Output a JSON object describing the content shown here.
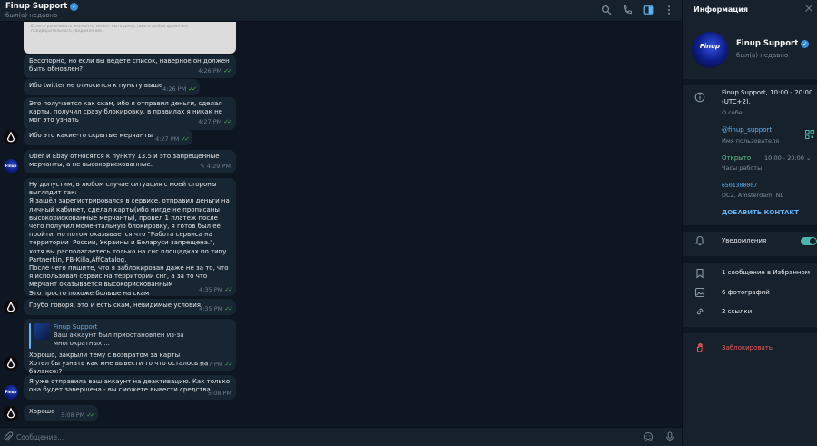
{
  "header": {
    "title": "Finup Support",
    "status": "был(а) недавно"
  },
  "image_fragment": {
    "faint_text": "Если ограничивать мерчанты может быть допустимо в любой время без предварительного уведомления."
  },
  "messages": [
    {
      "text": "Бесспорно, но если вы ведете список, наверное он должен быть обновлен?",
      "time": "4:26 PM",
      "ticks": "✓✓"
    },
    {
      "text": "Ибо twitter не относится к пункту выше",
      "time": "4:26 PM",
      "ticks": "✓✓"
    },
    {
      "text": "Это получается как скам, ибо я отправил деньги, сделал карты, получил сразу блокировку, в правилах я никак не мог это узнать",
      "time": "4:27 PM",
      "ticks": "✓✓"
    },
    {
      "text": "Ибо это какие-то скрытые мерчанты",
      "time": "4:27 PM",
      "ticks": "✓✓"
    },
    {
      "text": "Uber и Ebay относятся к пункту 13.5 и это запрещенные мерчанты, а не высокорискованные.",
      "time": "4:29 PM",
      "edited": "✎"
    },
    {
      "text": "Ну допустим, в любом случае ситуация с моей стороны выглядит так:\nЯ зашёл зарегистрировался в сервисе, отправил деньги на личный кабинет, сделал карты(ибо нигде не прописаны высокорискованные мерчанты), провел 1 платеж после чего получил моментальную блокировку, я готов был её пройти, но потом оказывается,что \"Работа сервиса на территории  России, Украины и Беларуси запрещена.\", хотя вы располагаетесь только на снг площадках по типу Partnerkin, FB-Killa,AffCatalog.\nПосле чего пишите, что я заблокирован даже не за то, что я использовал сервис на территории снг, а за то что мерчант оказывается высокорискованным\nЭто просто похоже больше на скам",
      "time": "4:35 PM",
      "ticks": "✓✓"
    },
    {
      "text": "Грубо говоря, это и есть скам, невидимые условия",
      "time": "4:35 PM",
      "ticks": "✓✓"
    },
    {
      "reply_name": "Finup Support",
      "reply_text": "Ваш аккаунт был приостановлен из-за многократных ...",
      "text": "Хорошо, закрыли тему с возвратом за карты\nХотел бы узнать как мне вывести то что осталось на балансе:?",
      "time": "5:07 PM",
      "ticks": "✓✓"
    },
    {
      "text": "Я уже отправила ваш аккаунт на деактивацию. Как только она будет завершена - вы сможете вывести средства.",
      "time": "5:08 PM"
    },
    {
      "text": "Хорошо",
      "time": "5:08 PM",
      "ticks": "✓✓"
    }
  ],
  "compose": {
    "placeholder": "Сообщение..."
  },
  "info": {
    "title": "Информация",
    "avatar_text": "Finup",
    "name": "Finup Support",
    "status": "был(а) недавно",
    "bio": "Finup Support, 10:00 - 20:00 (UTC+2).",
    "bio_label": "О себе",
    "username": "@finup_support",
    "username_label": "Имя пользователя",
    "hours_status": "Открыто",
    "hours_range": "10:00 - 20:00",
    "hours_label": "Часы работы",
    "phone": "6501300007",
    "address": "DC2, Amsterdam, NL",
    "add_contact": "ДОБАВИТЬ КОНТАКТ",
    "notifications": "Уведомления",
    "notifications_on": true,
    "saved": "1 сообщение в Избранном",
    "photos": "6 фотографий",
    "links": "2 ссылки",
    "block": "Заблокировать"
  },
  "colors": {
    "accent": "#5eb5f7",
    "bubble": "#182533",
    "panel": "#17212b",
    "background": "#0e1621",
    "read_ticks": "#4fae4e",
    "danger": "#e35d5d",
    "toggle": "#4db6ac"
  },
  "icons": [
    "search-icon",
    "phone-icon",
    "sidebar-toggle-icon",
    "more-icon",
    "attach-icon",
    "emoji-icon",
    "mic-icon",
    "close-icon",
    "info-icon",
    "qr-icon",
    "bell-icon",
    "bookmark-icon",
    "image-icon",
    "link-icon",
    "block-icon"
  ]
}
